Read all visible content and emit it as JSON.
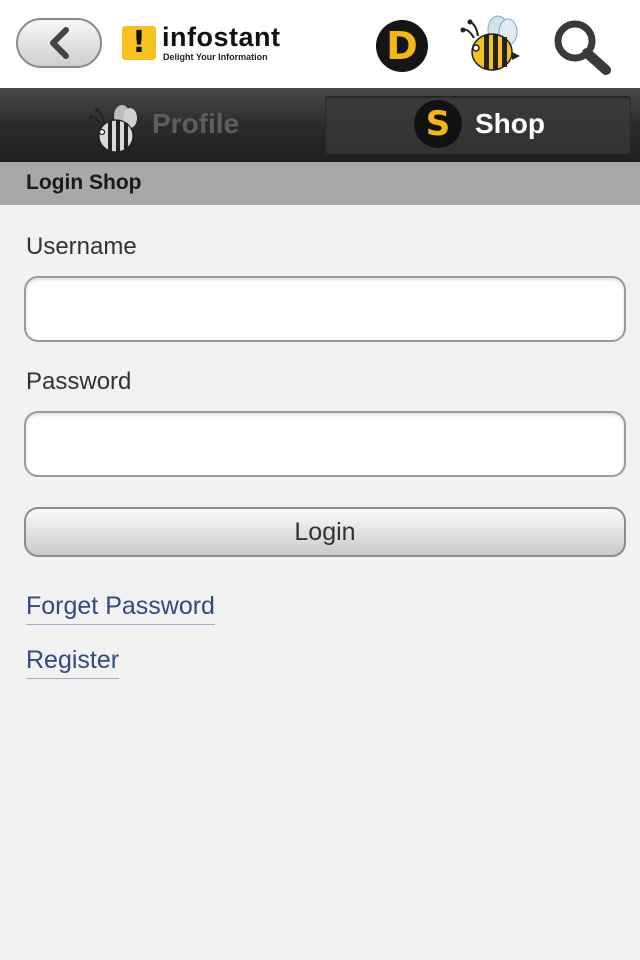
{
  "header": {
    "back_icon": "chevron-left-icon",
    "logo_mark": "!",
    "logo_name": "infostant",
    "logo_tagline": "Delight Your Information",
    "d_badge": "D",
    "bee_icon": "bee-icon",
    "search_icon": "search-icon"
  },
  "tabs": {
    "profile_label": "Profile",
    "shop_badge": "S",
    "shop_label": "Shop"
  },
  "section": {
    "title": "Login Shop"
  },
  "form": {
    "username_label": "Username",
    "username_value": "",
    "password_label": "Password",
    "password_value": "",
    "login_label": "Login"
  },
  "links": {
    "forget_password": "Forget Password",
    "register": "Register"
  },
  "colors": {
    "accent_yellow": "#f6b619",
    "link_blue": "#2f4b80",
    "tabbar_dark": "#2b2b2b",
    "section_gray": "#a8a8a8",
    "background": "#f2f2f2"
  }
}
